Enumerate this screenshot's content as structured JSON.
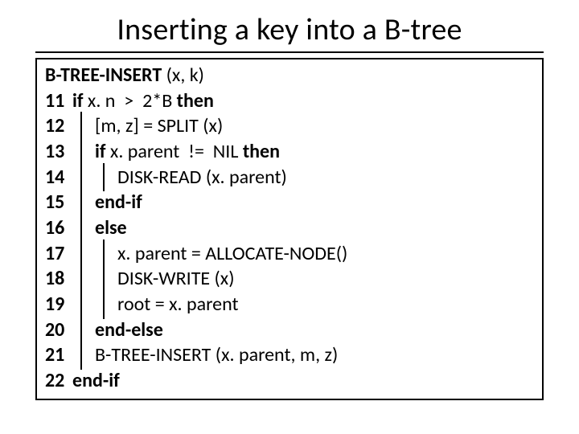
{
  "title": "Inserting a key into a B-tree",
  "header_bold": "B-TREE-INSERT",
  "header_rest": " (x, k)",
  "lines": [
    {
      "ln": "11",
      "indent": 0,
      "bars": [],
      "pre_bold": "if",
      "mid": " x. n  >  2*B ",
      "post_bold": "then"
    },
    {
      "ln": "12",
      "indent": 1,
      "bars": [
        0
      ],
      "pre_bold": "",
      "mid": "[m, z] = SPLIT (x)",
      "post_bold": ""
    },
    {
      "ln": "13",
      "indent": 1,
      "bars": [
        0
      ],
      "pre_bold": "if",
      "mid": " x. parent  !=  NIL ",
      "post_bold": "then"
    },
    {
      "ln": "14",
      "indent": 2,
      "bars": [
        0,
        1
      ],
      "pre_bold": "",
      "mid": "DISK-READ (x. parent)",
      "post_bold": ""
    },
    {
      "ln": "15",
      "indent": 1,
      "bars": [
        0
      ],
      "pre_bold": "end-if",
      "mid": "",
      "post_bold": ""
    },
    {
      "ln": "16",
      "indent": 1,
      "bars": [
        0
      ],
      "pre_bold": "else",
      "mid": "",
      "post_bold": ""
    },
    {
      "ln": "17",
      "indent": 2,
      "bars": [
        0,
        1
      ],
      "pre_bold": "",
      "mid": "x. parent = ALLOCATE-NODE()",
      "post_bold": ""
    },
    {
      "ln": "18",
      "indent": 2,
      "bars": [
        0,
        1
      ],
      "pre_bold": "",
      "mid": "DISK-WRITE (x)",
      "post_bold": ""
    },
    {
      "ln": "19",
      "indent": 2,
      "bars": [
        0,
        1
      ],
      "pre_bold": "",
      "mid": "root = x. parent",
      "post_bold": ""
    },
    {
      "ln": "20",
      "indent": 1,
      "bars": [
        0
      ],
      "pre_bold": "end-else",
      "mid": "",
      "post_bold": ""
    },
    {
      "ln": "21",
      "indent": 1,
      "bars": [
        0
      ],
      "pre_bold": "",
      "mid": "B-TREE-INSERT (x. parent, m, z)",
      "post_bold": ""
    },
    {
      "ln": "22",
      "indent": 0,
      "bars": [],
      "pre_bold": "end-if",
      "mid": "",
      "post_bold": ""
    }
  ]
}
